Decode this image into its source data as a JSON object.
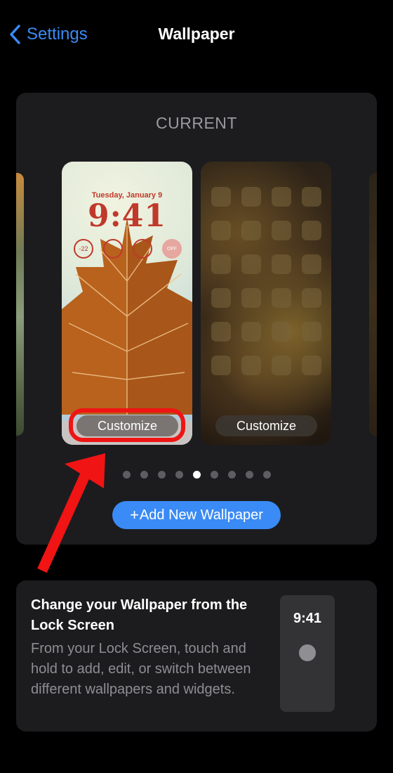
{
  "nav": {
    "back_label": "Settings",
    "title": "Wallpaper"
  },
  "current": {
    "label": "CURRENT",
    "lock_screen": {
      "date": "Tuesday, January 9",
      "time": "9:41",
      "widgets": [
        "-22",
        "",
        "",
        "OFF"
      ],
      "customize_label": "Customize"
    },
    "home_screen": {
      "customize_label": "Customize"
    },
    "page_dots": {
      "count": 9,
      "active_index": 4
    },
    "add_button_label": "Add New Wallpaper"
  },
  "info": {
    "title": "Change your Wallpaper from the Lock Screen",
    "description": "From your Lock Screen, touch and hold to add, edit, or switch between different wallpapers and widgets.",
    "preview_time": "9:41"
  },
  "colors": {
    "accent": "#3a8bf5",
    "highlight": "#f01414",
    "lock_time": "#c0392b"
  }
}
